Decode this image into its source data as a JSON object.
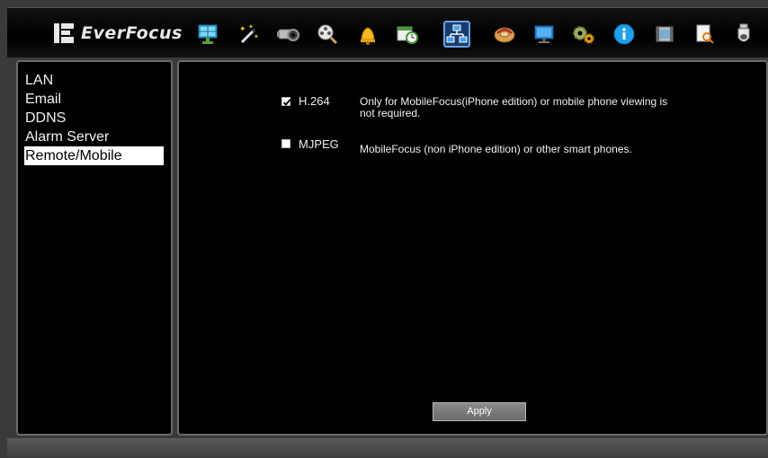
{
  "header": {
    "brand": "EverFocus",
    "toolbar_icons": [
      "display-icon",
      "magic-wand-icon",
      "camera-icon",
      "film-reel-search-icon",
      "alarm-bell-icon",
      "schedule-icon",
      "network-icon",
      "disk-icon",
      "monitor-icon",
      "settings-gears-icon",
      "info-icon",
      "video-clip-icon",
      "search-log-icon",
      "ptz-dome-icon"
    ],
    "active_icon": "network-icon"
  },
  "sidebar": {
    "items": [
      {
        "label": "LAN"
      },
      {
        "label": "Email"
      },
      {
        "label": "DDNS"
      },
      {
        "label": "Alarm Server"
      },
      {
        "label": "Remote/Mobile"
      }
    ],
    "selected": "Remote/Mobile"
  },
  "main": {
    "options": [
      {
        "label": "H.264",
        "checked": true,
        "description": "Only for MobileFocus(iPhone edition) or mobile phone viewing is not required."
      },
      {
        "label": "MJPEG",
        "checked": false,
        "description": "MobileFocus (non iPhone edition) or other smart phones."
      }
    ],
    "apply_label": "Apply"
  },
  "colors": {
    "background": "#000000",
    "panel_border": "#6a6a6a",
    "active_icon_bg": "#173c6e",
    "selected_item_bg": "#ffffff"
  }
}
